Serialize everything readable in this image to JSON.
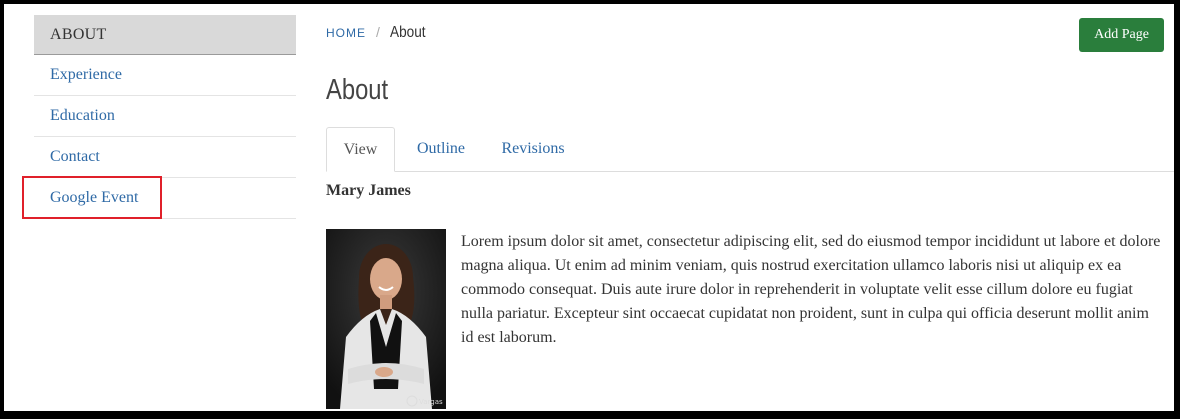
{
  "sidebar": {
    "header": "ABOUT",
    "items": [
      {
        "label": "Experience"
      },
      {
        "label": "Education"
      },
      {
        "label": "Contact"
      },
      {
        "label": "Google Event"
      }
    ]
  },
  "breadcrumb": {
    "home": "HOME",
    "separator": "/",
    "current": "About"
  },
  "actions": {
    "add_page": "Add Page"
  },
  "page": {
    "title": "About"
  },
  "tabs": [
    {
      "label": "View",
      "active": true
    },
    {
      "label": "Outline",
      "active": false
    },
    {
      "label": "Revisions",
      "active": false
    }
  ],
  "content": {
    "author": "Mary James",
    "paragraph": "Lorem ipsum dolor sit amet, consectetur adipiscing elit, sed do eiusmod tempor incididunt ut labore et dolore magna aliqua. Ut enim ad minim veniam, quis nostrud exercitation ullamco laboris nisi ut aliquip ex ea commodo consequat. Duis aute irure dolor in reprehenderit in voluptate velit esse cillum dolore eu fugiat nulla pariatur. Excepteur sint occaecat cupidatat non proident, sunt in culpa qui officia deserunt mollit anim id est laborum.",
    "photo_watermark": "Vargas"
  },
  "colors": {
    "link": "#2f6aa6",
    "button": "#2a7e3c",
    "highlight": "#e0202a"
  }
}
